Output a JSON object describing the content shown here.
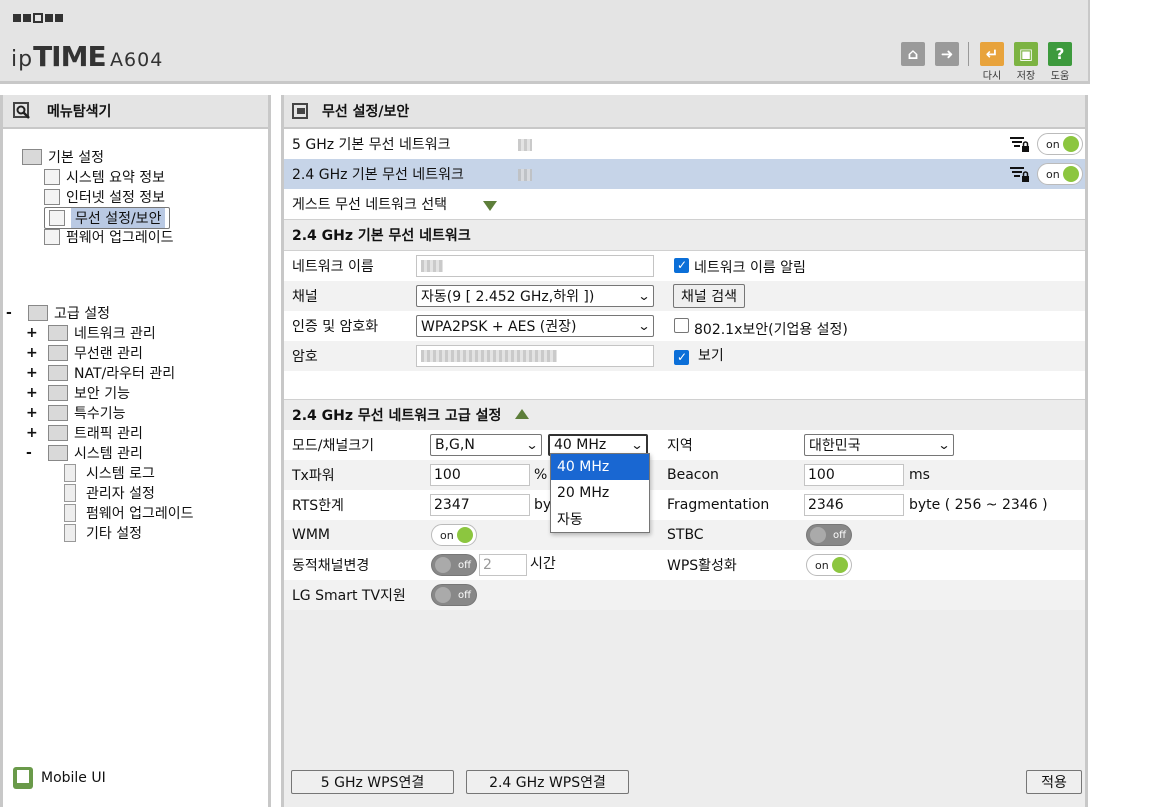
{
  "header": {
    "brand_ip": "ip",
    "brand_time": "TIME",
    "model": "A604",
    "buttons": [
      {
        "icon": "home-icon",
        "label": ""
      },
      {
        "icon": "logout-icon",
        "label": ""
      },
      {
        "icon": "restart-icon",
        "label": "다시"
      },
      {
        "icon": "save-icon",
        "label": "저장"
      },
      {
        "icon": "help-icon",
        "label": "도움"
      }
    ]
  },
  "left": {
    "title": "메뉴탐색기",
    "basic": {
      "label": "기본 설정",
      "items": [
        "시스템 요약 정보",
        "인터넷 설정 정보",
        "무선 설정/보안",
        "펌웨어 업그레이드"
      ]
    },
    "advanced": {
      "sign": "-",
      "label": "고급 설정",
      "items": [
        {
          "sign": "+",
          "label": "네트워크 관리"
        },
        {
          "sign": "+",
          "label": "무선랜 관리"
        },
        {
          "sign": "+",
          "label": "NAT/라우터 관리"
        },
        {
          "sign": "+",
          "label": "보안 기능"
        },
        {
          "sign": "+",
          "label": "특수기능"
        },
        {
          "sign": "+",
          "label": "트래픽 관리"
        },
        {
          "sign": "-",
          "label": "시스템 관리"
        }
      ],
      "system_items": [
        "시스템 로그",
        "관리자 설정",
        "펌웨어 업그레이드",
        "기타 설정"
      ]
    },
    "mobile_ui": "Mobile UI"
  },
  "main": {
    "title": "무선 설정/보안",
    "networks": [
      {
        "name": "5 GHz 기본 무선 네트워크",
        "toggle": "on"
      },
      {
        "name": "2.4 GHz 기본 무선 네트워크",
        "toggle": "on"
      }
    ],
    "guest_select": "게스트 무선 네트워크 선택",
    "basic_section": {
      "title": "2.4 GHz 기본 무선 네트워크",
      "network_name_label": "네트워크 이름",
      "broadcast_label": "네트워크 이름 알림",
      "broadcast_checked": true,
      "channel_label": "채널",
      "channel_value": "자동(9 [ 2.452 GHz,하위 ])",
      "channel_scan": "채널 검색",
      "auth_label": "인증 및 암호화",
      "auth_value": "WPA2PSK + AES (권장)",
      "enterprise_label": "802.1x보안(기업용 설정)",
      "enterprise_checked": false,
      "password_label": "암호",
      "show_label": "보기",
      "show_checked": true
    },
    "advanced_section": {
      "title": "2.4 GHz 무선 네트워크 고급 설정",
      "mode_label": "모드/채널크기",
      "mode_value": "B,G,N",
      "width_value": "40 MHz",
      "width_options": [
        "40 MHz",
        "20 MHz",
        "자동"
      ],
      "region_label": "지역",
      "region_value": "대한민국",
      "tx_label": "Tx파워",
      "tx_value": "100",
      "tx_unit": "%",
      "beacon_label": "Beacon",
      "beacon_value": "100",
      "beacon_unit": "ms",
      "rts_label": "RTS한계",
      "rts_value": "2347",
      "rts_unit": "by",
      "frag_label": "Fragmentation",
      "frag_value": "2346",
      "frag_unit": "byte ( 256 ~ 2346 )",
      "wmm_label": "WMM",
      "wmm": "on",
      "stbc_label": "STBC",
      "stbc": "off",
      "dyn_label": "동적채널변경",
      "dyn": "off",
      "dyn_value": "2",
      "dyn_unit": "시간",
      "wps_label": "WPS활성화",
      "wps": "on",
      "lgtv_label": "LG Smart TV지원",
      "lgtv": "off"
    },
    "footer": {
      "wps5": "5 GHz WPS연결",
      "wps24": "2.4 GHz WPS연결",
      "apply": "적용"
    }
  },
  "colors": {
    "header_bg": "#e4e4e4",
    "selected_row": "#c6d4e8",
    "toggle_on": "#8cc63f",
    "dropdown_active": "#1967d2",
    "btn_orange": "#e8a33c",
    "btn_green": "#7cb342",
    "btn_green_help": "#3d9a3d"
  }
}
